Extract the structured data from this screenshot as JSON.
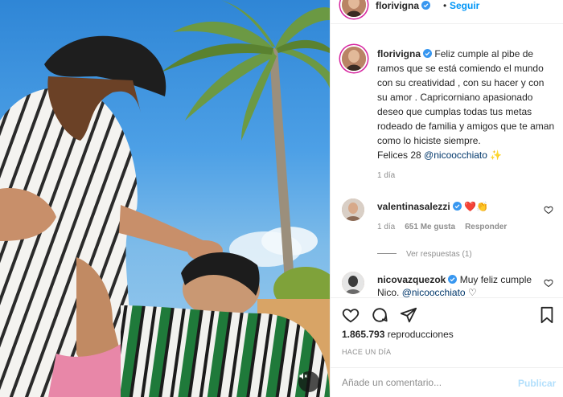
{
  "post": {
    "username": "florivigna",
    "follow_label": "Seguir",
    "separator": "•",
    "caption": {
      "text_1": "Feliz cumple al pibe de ramos que se está comiendo el mundo con su creatividad , con su hacer y con su amor . Capricorniano apasionado deseo que cumplas todas tus metas rodeado de familia y amigos que te aman como lo hiciste siempre.",
      "text_2": "Felices 28",
      "mention": "@nicoocchiato",
      "emoji": "✨",
      "time": "1 día"
    },
    "comments": [
      {
        "username": "valentinasalezzi",
        "emoji": "❤️👏",
        "time": "1 día",
        "likes": "651 Me gusta",
        "reply_label": "Responder",
        "view_replies": "Ver respuestas (1)"
      },
      {
        "username": "nicovazquezok",
        "text": "Muy feliz cumple Nico.",
        "mention": "@nicoocchiato",
        "trailing_emoji": "♡"
      }
    ],
    "views_count": "1.865.793",
    "views_label": "reproducciones",
    "date_label": "HACE UN DÍA",
    "comment_placeholder": "Añade un comentario...",
    "publish_label": "Publicar"
  },
  "icons": {
    "verified": "verified-badge-icon",
    "like": "heart-icon",
    "comment": "comment-bubble-icon",
    "share": "paper-plane-icon",
    "save": "bookmark-icon",
    "mute": "speaker-muted-icon"
  },
  "colors": {
    "link_blue": "#0095f6",
    "mention_blue": "#00376b",
    "muted_text": "#8e8e8e",
    "publish_disabled": "#b2dffc",
    "sky": "#4da0e6"
  }
}
